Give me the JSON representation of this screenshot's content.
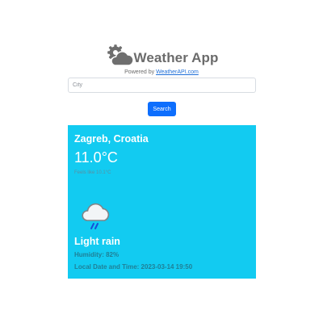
{
  "app": {
    "title": "Weather App",
    "powered_by_prefix": "Powered by",
    "powered_by_link": "WeatherAPI.com",
    "logo_icon": "gear-cloud-icon"
  },
  "search": {
    "placeholder": "City",
    "value": "",
    "button_label": "Search"
  },
  "weather": {
    "location": "Zagreb, Croatia",
    "temperature": "11.0°C",
    "feels_like": "Feels like 10.1°C",
    "condition_icon": "light-rain-cloud-icon",
    "condition": "Light rain",
    "humidity": "Humidity: 82%",
    "local_datetime": "Local Date and Time: 2023-03-14 19:50"
  },
  "colors": {
    "card_background": "#12cbf1",
    "button": "#0d6efd",
    "link": "#1f6fd8"
  }
}
